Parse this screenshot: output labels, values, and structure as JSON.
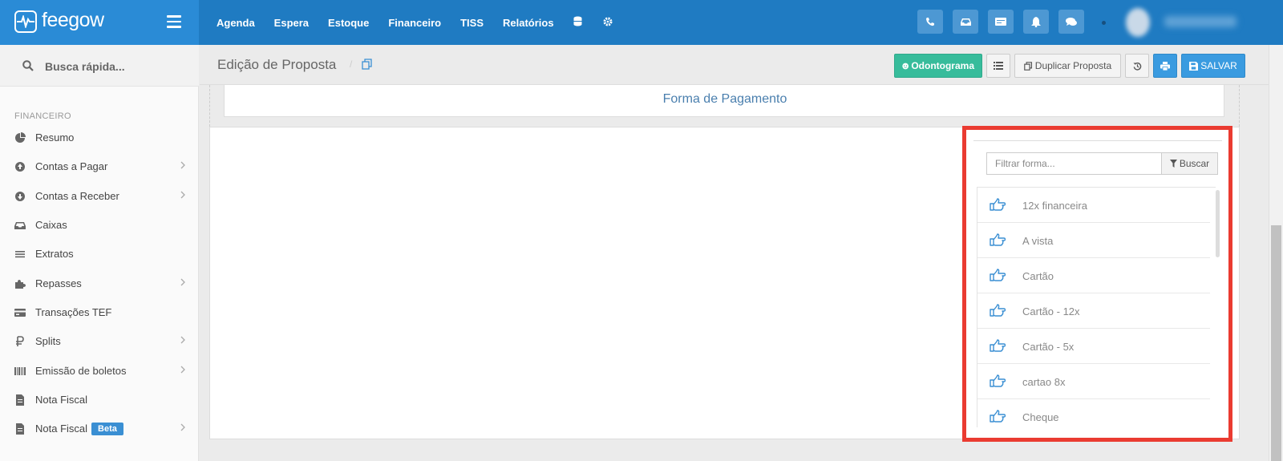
{
  "brand": {
    "name": "feegow"
  },
  "topnav": {
    "items": [
      {
        "label": "Agenda"
      },
      {
        "label": "Espera"
      },
      {
        "label": "Estoque"
      },
      {
        "label": "Financeiro"
      },
      {
        "label": "TISS"
      },
      {
        "label": "Relatórios"
      }
    ],
    "extra_icons": [
      "database-icon",
      "gear-icon"
    ],
    "right_icons": [
      "phone-icon",
      "inbox-icon",
      "card-icon",
      "bell-icon",
      "chat-icon"
    ]
  },
  "sidebar": {
    "search_placeholder": "Busca rápida...",
    "section_title": "FINANCEIRO",
    "items": [
      {
        "label": "Resumo",
        "icon": "pie-chart-icon",
        "has_children": false
      },
      {
        "label": "Contas a Pagar",
        "icon": "arrow-up-circle-icon",
        "has_children": true
      },
      {
        "label": "Contas a Receber",
        "icon": "arrow-down-circle-icon",
        "has_children": true
      },
      {
        "label": "Caixas",
        "icon": "inbox-icon",
        "has_children": false
      },
      {
        "label": "Extratos",
        "icon": "list-icon",
        "has_children": false
      },
      {
        "label": "Repasses",
        "icon": "puzzle-icon",
        "has_children": true
      },
      {
        "label": "Transações TEF",
        "icon": "credit-card-icon",
        "has_children": false
      },
      {
        "label": "Splits",
        "icon": "ruble-icon",
        "has_children": true
      },
      {
        "label": "Emissão de boletos",
        "icon": "barcode-icon",
        "has_children": true
      },
      {
        "label": "Nota Fiscal",
        "icon": "file-icon",
        "has_children": false
      },
      {
        "label": "Nota Fiscal",
        "icon": "file-icon",
        "has_children": true,
        "badge": "Beta"
      }
    ]
  },
  "page": {
    "title": "Edição de Proposta",
    "buttons": {
      "odontograma": "Odontograma",
      "duplicar": "Duplicar Proposta",
      "salvar": "SALVAR"
    }
  },
  "content": {
    "section_title": "Forma de Pagamento",
    "filter_placeholder": "Filtrar forma...",
    "filter_button": "Buscar",
    "payment_methods": [
      {
        "label": "12x financeira"
      },
      {
        "label": "A vista"
      },
      {
        "label": "Cartão"
      },
      {
        "label": "Cartão - 12x"
      },
      {
        "label": "Cartão - 5x"
      },
      {
        "label": "cartao 8x"
      },
      {
        "label": "Cheque"
      }
    ]
  },
  "colors": {
    "topbar": "#1f7bc2",
    "brand_bg": "#2a8bd6",
    "green_button": "#37bc9b",
    "blue_button": "#3a9be0",
    "highlight_border": "#ea3b31",
    "icon_blue": "#3a8fd3"
  }
}
